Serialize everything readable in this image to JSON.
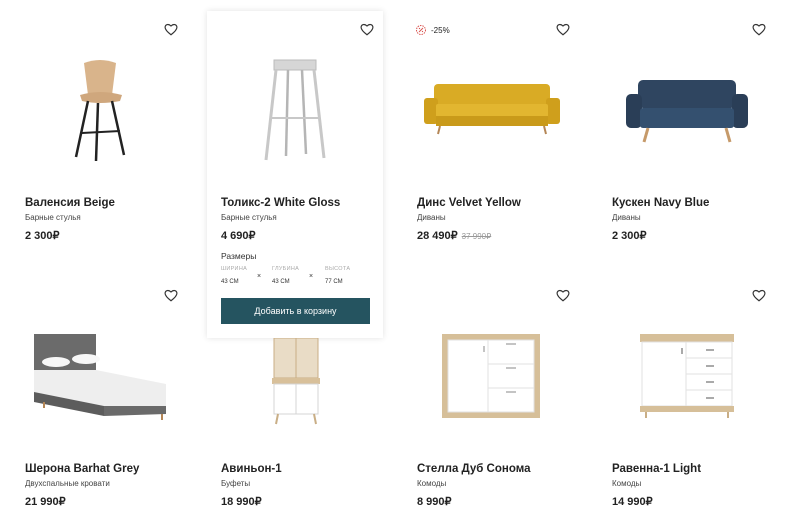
{
  "products": [
    {
      "name": "Валенсия Beige",
      "category": "Барные стулья",
      "price": "2 300₽"
    },
    {
      "name": "Толикс-2 White Gloss",
      "category": "Барные стулья",
      "price": "4 690₽"
    },
    {
      "name": "Динс Velvet Yellow",
      "category": "Диваны",
      "price": "28 490₽",
      "old_price": "37 990₽",
      "discount": "-25%"
    },
    {
      "name": "Кускен Navy Blue",
      "category": "Диваны",
      "price": "2 300₽"
    },
    {
      "name": "Шерона Barhat Grey",
      "category": "Двухспальные кровати",
      "price": "21 990₽"
    },
    {
      "name": "Авиньон-1",
      "category": "Буфеты",
      "price": "18 990₽"
    },
    {
      "name": "Стелла Дуб Сонома",
      "category": "Комоды",
      "price": "8 990₽"
    },
    {
      "name": "Равенна-1 Light",
      "category": "Комоды",
      "price": "14 990₽"
    }
  ],
  "sizes": {
    "title": "Размеры",
    "width_label": "ШИРИНА",
    "width_value": "43 СМ",
    "depth_label": "ГЛУБИНА",
    "depth_value": "43 СМ",
    "height_label": "ВЫСОТА",
    "height_value": "77 СМ",
    "separator": "×"
  },
  "add_to_cart_label": "Добавить в корзину",
  "colors": {
    "accent": "#255460",
    "discount": "#d9534f"
  },
  "icons": {
    "favorite": "heart-icon",
    "discount": "discount-badge-icon"
  }
}
